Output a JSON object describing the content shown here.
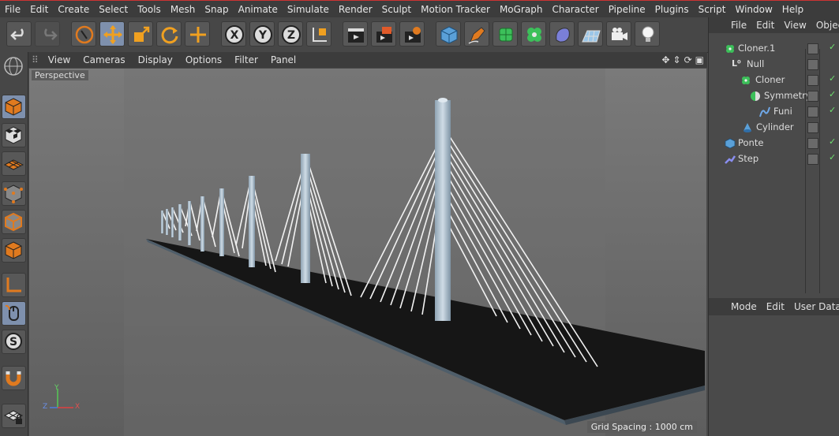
{
  "menubar": [
    "File",
    "Edit",
    "Create",
    "Select",
    "Tools",
    "Mesh",
    "Snap",
    "Animate",
    "Simulate",
    "Render",
    "Sculpt",
    "Motion Tracker",
    "MoGraph",
    "Character",
    "Pipeline",
    "Plugins",
    "Script",
    "Window",
    "Help"
  ],
  "viewport": {
    "menu": [
      "View",
      "Cameras",
      "Display",
      "Options",
      "Filter",
      "Panel"
    ],
    "camera_label": "Perspective",
    "grid_spacing": "Grid Spacing : 1000 cm"
  },
  "objects": {
    "menu": [
      "File",
      "Edit",
      "View",
      "Object"
    ],
    "items": [
      {
        "name": "Cloner.1",
        "icon": "cloner-icon"
      },
      {
        "name": "Null",
        "icon": "null-icon"
      },
      {
        "name": "Cloner",
        "icon": "cloner-icon"
      },
      {
        "name": "Symmetry",
        "icon": "symmetry-icon"
      },
      {
        "name": "Funi",
        "icon": "spline-icon"
      },
      {
        "name": "Cylinder",
        "icon": "cylinder-icon"
      },
      {
        "name": "Ponte",
        "icon": "cube-icon"
      },
      {
        "name": "Step",
        "icon": "effector-icon"
      }
    ]
  },
  "attributes": {
    "menu": [
      "Mode",
      "Edit",
      "User Data"
    ]
  },
  "axis": {
    "x": "X",
    "y": "Y",
    "z": "Z"
  },
  "colors": {
    "accent": "#7e90ad",
    "check": "#6fe06f",
    "menubar": "#3c3c3c"
  }
}
